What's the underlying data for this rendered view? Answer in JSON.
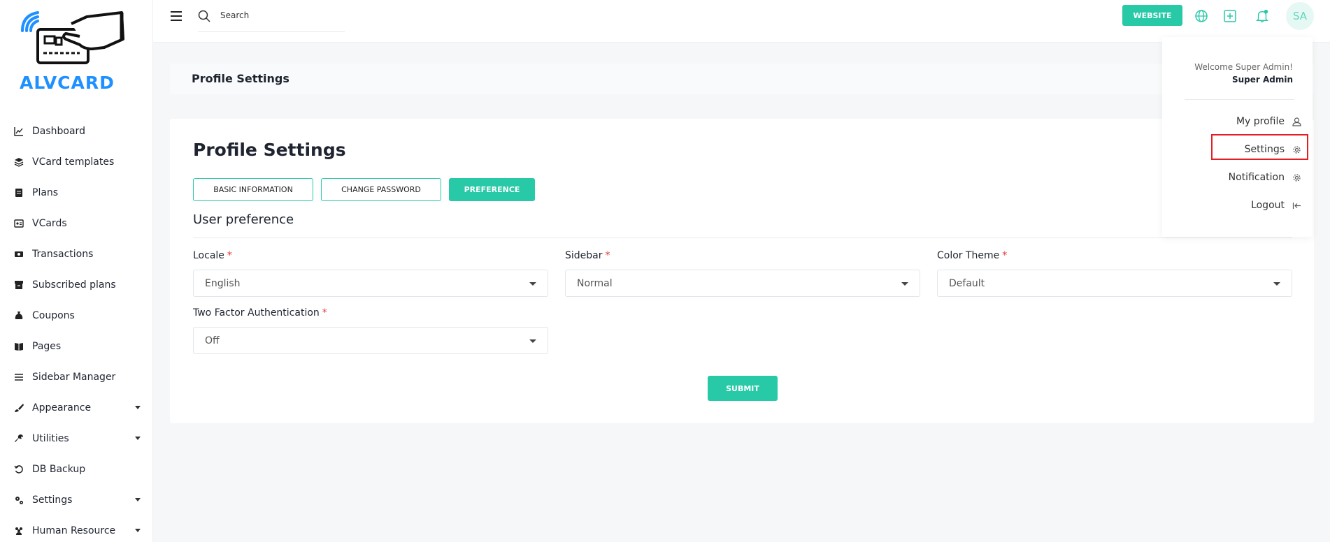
{
  "brand": {
    "name": "ALVCARD",
    "color": "#1e90ff"
  },
  "sidebar": {
    "items": [
      {
        "label": "Dashboard",
        "icon": "chart-line-icon",
        "caret": false
      },
      {
        "label": "VCard templates",
        "icon": "layers-icon",
        "caret": false
      },
      {
        "label": "Plans",
        "icon": "clipboard-icon",
        "caret": false
      },
      {
        "label": "VCards",
        "icon": "id-card-icon",
        "caret": false
      },
      {
        "label": "Transactions",
        "icon": "money-icon",
        "caret": false
      },
      {
        "label": "Subscribed plans",
        "icon": "archive-icon",
        "caret": false
      },
      {
        "label": "Coupons",
        "icon": "money-bag-icon",
        "caret": false
      },
      {
        "label": "Pages",
        "icon": "book-icon",
        "caret": false
      },
      {
        "label": "Sidebar Manager",
        "icon": "bars-icon",
        "caret": false
      },
      {
        "label": "Appearance",
        "icon": "brush-icon",
        "caret": true
      },
      {
        "label": "Utilities",
        "icon": "wrench-icon",
        "caret": true
      },
      {
        "label": "DB Backup",
        "icon": "undo-icon",
        "caret": false
      },
      {
        "label": "Settings",
        "icon": "cogs-icon",
        "caret": true
      },
      {
        "label": "Human Resource",
        "icon": "users-icon",
        "caret": true
      }
    ]
  },
  "topbar": {
    "search_placeholder": "Search",
    "website_label": "WEBSITE",
    "avatar_initials": "SA",
    "icons": [
      "globe-icon",
      "plus-square-icon",
      "bell-icon"
    ]
  },
  "header": {
    "title": "Profile Settings"
  },
  "main": {
    "title": "Profile Settings",
    "tabs": [
      {
        "label": "BASIC INFORMATION",
        "active": false
      },
      {
        "label": "CHANGE PASSWORD",
        "active": false
      },
      {
        "label": "PREFERENCE",
        "active": true
      }
    ],
    "section_title": "User preference",
    "fields": {
      "locale": {
        "label": "Locale",
        "required": "*",
        "value": "English"
      },
      "sidebar": {
        "label": "Sidebar",
        "required": "*",
        "value": "Normal"
      },
      "color_theme": {
        "label": "Color Theme",
        "required": "*",
        "value": "Default"
      },
      "two_factor": {
        "label": "Two Factor Authentication",
        "required": "*",
        "value": "Off"
      }
    },
    "submit_label": "SUBMIT"
  },
  "dropdown": {
    "welcome": "Welcome Super Admin!",
    "name": "Super Admin",
    "items": [
      {
        "label": "My profile",
        "icon": "user-icon"
      },
      {
        "label": "Settings",
        "icon": "gear-icon"
      },
      {
        "label": "Notification",
        "icon": "gear-icon"
      },
      {
        "label": "Logout",
        "icon": "logout-icon"
      }
    ]
  },
  "colors": {
    "accent": "#27c9a7",
    "highlight": "#e31e24",
    "required": "#e53935"
  }
}
